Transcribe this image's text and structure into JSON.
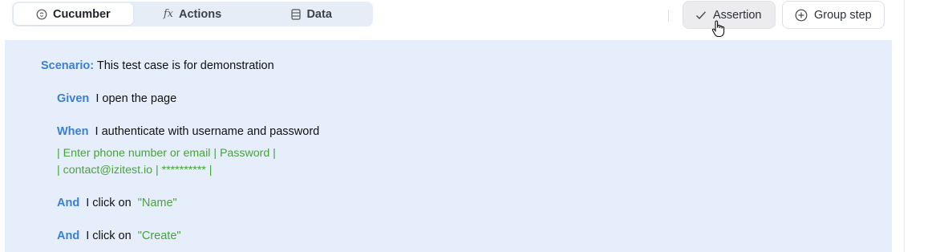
{
  "tabs": [
    {
      "label": "Cucumber",
      "icon": "cucumber-icon",
      "active": true
    },
    {
      "label": "Actions",
      "icon": "fx-icon",
      "active": false
    },
    {
      "label": "Data",
      "icon": "data-icon",
      "active": false
    }
  ],
  "toolbar": {
    "assertion_label": "Assertion",
    "group_step_label": "Group step"
  },
  "icons": {
    "fx_glyph": "fx"
  },
  "scenario": {
    "keyword": "Scenario:",
    "title": "This test case is for demonstration",
    "steps": [
      {
        "keyword": "Given",
        "text": "I open the page"
      },
      {
        "keyword": "When",
        "text": "I authenticate with username and password",
        "table": [
          "| Enter phone number or email | Password |",
          "| contact@izitest.io | ********** |"
        ]
      },
      {
        "keyword": "And",
        "text": "I click on",
        "arg": "\"Name\""
      },
      {
        "keyword": "And",
        "text": "I click on",
        "arg": "\"Create\""
      }
    ]
  },
  "colors": {
    "keyword": "#3a7fd5",
    "string": "#49a33c",
    "editor_bg": "#e5eefa",
    "tabs_bg": "#e6edf7"
  }
}
